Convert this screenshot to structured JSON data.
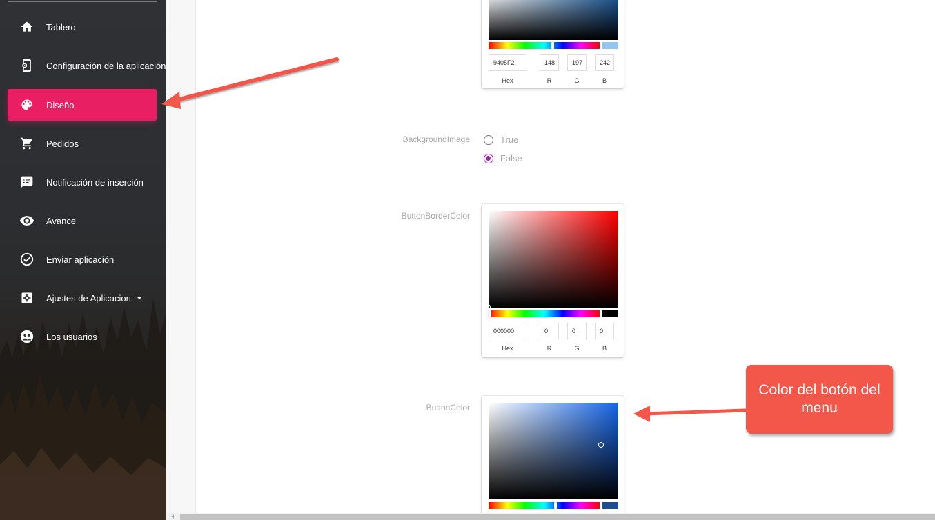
{
  "sidebar": {
    "items": [
      {
        "label": "Tablero",
        "icon": "home-icon"
      },
      {
        "label": "Configuración de la aplicación",
        "icon": "app-settings-icon"
      },
      {
        "label": "Diseño",
        "icon": "palette-icon",
        "active": true
      },
      {
        "label": "Pedidos",
        "icon": "cart-icon"
      },
      {
        "label": "Notificación de inserción",
        "icon": "message-icon"
      },
      {
        "label": "Avance",
        "icon": "eye-icon"
      },
      {
        "label": "Enviar aplicación",
        "icon": "check-circle-icon"
      },
      {
        "label": "Ajustes de Aplicacion",
        "icon": "gear-box-icon",
        "has_dropdown": true
      },
      {
        "label": "Los usuarios",
        "icon": "users-icon"
      }
    ],
    "active_color": "#e91e63"
  },
  "pickers": {
    "top": {
      "hex": "9405F2",
      "r": "148",
      "g": "197",
      "b": "242",
      "swatch": "#94c5f2"
    },
    "button_border_color": {
      "label": "ButtonBorderColor",
      "hex": "000000",
      "r": "0",
      "g": "0",
      "b": "0",
      "swatch": "#000000"
    },
    "button_color": {
      "label": "ButtonColor",
      "swatch": "#1e4d91"
    },
    "labels": {
      "hex": "Hex",
      "r": "R",
      "g": "G",
      "b": "B"
    }
  },
  "background_image": {
    "label": "BackgroundImage",
    "options": [
      "True",
      "False"
    ],
    "selected": "False"
  },
  "annotation": {
    "callout_text": "Color del botón del menu",
    "arrow_color": "#f3574a"
  }
}
